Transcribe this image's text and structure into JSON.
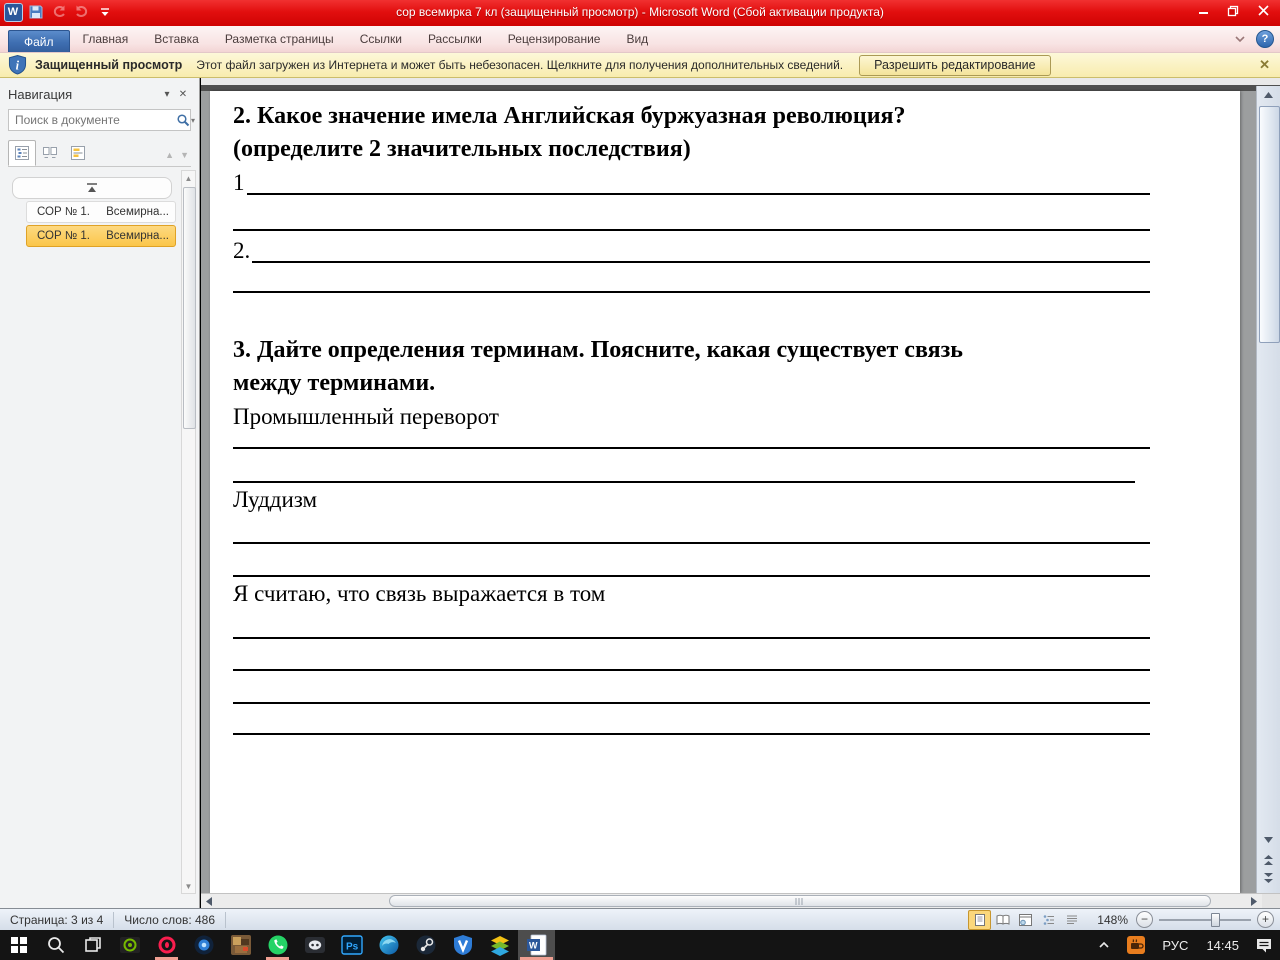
{
  "titlebar": {
    "title": "сор всемирка 7 кл (защищенный просмотр)  -  Microsoft Word (Сбой активации продукта)",
    "quick_access_icons": [
      "word-logo-icon",
      "save-icon",
      "undo-icon",
      "redo-icon",
      "customize-toolbar-icon"
    ],
    "window_buttons": [
      "minimize",
      "restore",
      "close"
    ]
  },
  "ribbon": {
    "file_tab": "Файл",
    "tabs": [
      "Главная",
      "Вставка",
      "Разметка страницы",
      "Ссылки",
      "Рассылки",
      "Рецензирование",
      "Вид"
    ],
    "right_icons": [
      "collapse-ribbon-icon",
      "help-icon"
    ]
  },
  "message_bar": {
    "icon": "shield-info-icon",
    "title": "Защищенный просмотр",
    "message": "Этот файл загружен из Интернета и может быть небезопасен. Щелкните для получения дополнительных сведений.",
    "button_label": "Разрешить редактирование"
  },
  "navigation_pane": {
    "title": "Навигация",
    "search_placeholder": "Поиск в документе",
    "tab_icons": [
      "browse-headings-icon",
      "browse-pages-icon",
      "browse-results-icon"
    ],
    "items": [
      {
        "title": "СОР № 1.",
        "subtitle": "Всемирна...",
        "selected": false
      },
      {
        "title": "СОР № 1.",
        "subtitle": "Всемирна...",
        "selected": true
      }
    ]
  },
  "document": {
    "blocks": [
      {
        "t": "h",
        "text": "2. Какое значение имела Английская буржуазная революция?"
      },
      {
        "t": "h",
        "text": "(определите 2 значительных последствия)"
      },
      {
        "t": "nl",
        "label": "1"
      },
      {
        "t": "line",
        "mt": 30
      },
      {
        "t": "nl",
        "label": "2.",
        "mt": 3
      },
      {
        "t": "line",
        "mt": 24
      },
      {
        "t": "h",
        "text": "3. Дайте определения терминам. Поясните, какая существует связь",
        "mt": 41
      },
      {
        "t": "h",
        "text": "между терминами."
      },
      {
        "t": "p",
        "text": "Промышленный переворот"
      },
      {
        "t": "line",
        "mt": 14
      },
      {
        "t": "line",
        "mt": 32,
        "short": true
      },
      {
        "t": "p",
        "text": "Луддизм"
      },
      {
        "t": "line",
        "mt": 26
      },
      {
        "t": "line",
        "mt": 31
      },
      {
        "t": "p",
        "text": "Я считаю, что связь выражается в том"
      },
      {
        "t": "line",
        "mt": 27
      },
      {
        "t": "line",
        "mt": 30
      },
      {
        "t": "line",
        "mt": 31
      },
      {
        "t": "line",
        "mt": 29
      }
    ]
  },
  "status_bar": {
    "page_indicator": "Страница: 3 из 4",
    "word_count": "Число слов: 486",
    "view_mode_icons": [
      "print-layout-icon",
      "full-screen-reading-icon",
      "web-layout-icon",
      "outline-icon",
      "draft-icon"
    ],
    "zoom_level": "148%"
  },
  "taskbar": {
    "icons": [
      {
        "name": "start"
      },
      {
        "name": "search"
      },
      {
        "name": "task-view"
      },
      {
        "name": "nvidia"
      },
      {
        "name": "opera",
        "running": true
      },
      {
        "name": "lens-browser"
      },
      {
        "name": "game"
      },
      {
        "name": "whatsapp",
        "running": true
      },
      {
        "name": "discord"
      },
      {
        "name": "photoshop"
      },
      {
        "name": "edge"
      },
      {
        "name": "steam"
      },
      {
        "name": "v-shield"
      },
      {
        "name": "layers"
      },
      {
        "name": "word",
        "running": true,
        "active": true
      }
    ],
    "tray": {
      "language": "РУС",
      "time": "14:45"
    }
  },
  "colors": {
    "titlebar_red": "#e20f0f",
    "file_tab_blue": "#3f6fb2",
    "protected_view_yellow": "#f8ecae",
    "selected_heading_orange": "#fbc64a",
    "running_indicator_salmon": "#ef9f92"
  }
}
